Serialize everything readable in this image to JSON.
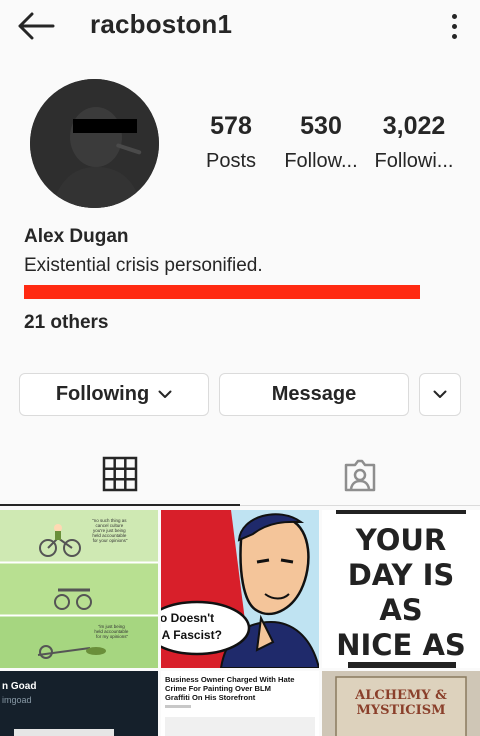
{
  "header": {
    "username": "racboston1",
    "back_icon": "arrow-left-icon",
    "more_icon": "more-vertical-icon"
  },
  "profile": {
    "stats": [
      {
        "value": "578",
        "label": "Posts"
      },
      {
        "value": "530",
        "label": "Follow..."
      },
      {
        "value": "3,022",
        "label": "Followi..."
      }
    ],
    "name": "Alex Dugan",
    "bio": "Existential crisis personified.",
    "followed_by_others": "21 others"
  },
  "actions": {
    "following_label": "Following",
    "message_label": "Message"
  },
  "tabs": [
    {
      "icon": "grid-icon",
      "active": true
    },
    {
      "icon": "tagged-person-icon",
      "active": false
    }
  ],
  "posts": [
    {
      "texts": [
        "\"no such thing as cancel culture you're just being held accountable for your opinions\"",
        "\"im just being held accountable for my opinions\""
      ]
    },
    {
      "texts": [
        "o Doesn't",
        "e A Fascist?"
      ]
    },
    {
      "texts": [
        "YOUR",
        "DAY IS",
        "AS",
        "NICE AS"
      ]
    },
    {
      "texts": [
        "n Goad",
        "imgoad"
      ]
    },
    {
      "texts": [
        "Business Owner Charged With Hate Crime For Painting Over BLM Graffiti On His Storefront"
      ]
    },
    {
      "texts": [
        "ALCHEMY &",
        "MYSTICISM"
      ]
    }
  ],
  "colors": {
    "accent_text": "#262626",
    "border": "#dbdbdb",
    "redaction": "#ff2a12"
  }
}
